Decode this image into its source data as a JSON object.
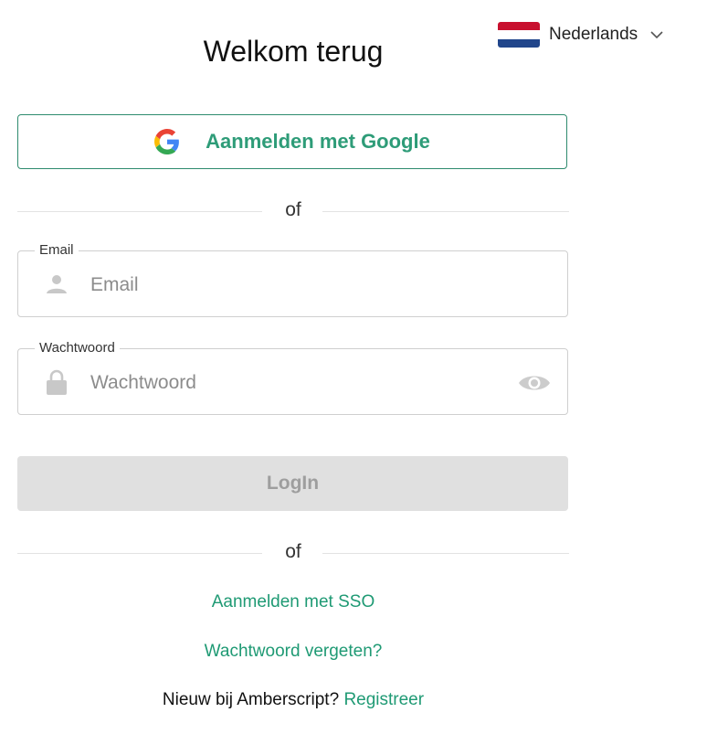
{
  "language": {
    "label": "Nederlands",
    "flag_colors": [
      "#c8102e",
      "#ffffff",
      "#21468b"
    ]
  },
  "title": "Welkom terug",
  "google_button": {
    "label": "Aanmelden met Google"
  },
  "or_text": "of",
  "email": {
    "label": "Email",
    "placeholder": "Email"
  },
  "password": {
    "label": "Wachtwoord",
    "placeholder": "Wachtwoord"
  },
  "login_button": {
    "label": "LogIn"
  },
  "links": {
    "sso": "Aanmelden met SSO",
    "forgot": "Wachtwoord vergeten?"
  },
  "register": {
    "prompt": "Nieuw bij Amberscript?",
    "link": "Registreer"
  },
  "colors": {
    "accent": "#1f9a74",
    "disabled_bg": "#e0e0e0",
    "disabled_text": "#9e9e9e"
  }
}
